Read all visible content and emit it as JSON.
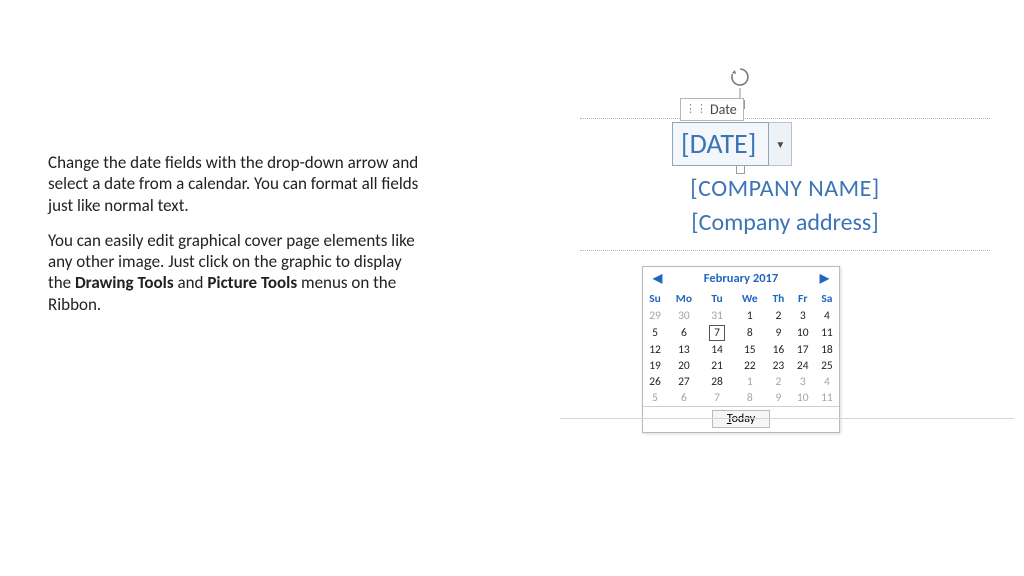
{
  "prose": {
    "p1": "Change the date fields with the drop-down arrow and select a date from a calendar. You can format all fields just like normal text.",
    "p2_a": "You can easily edit graphical cover page elements like any other image. Just click on the graphic to display the ",
    "p2_b": "Drawing Tools",
    "p2_c": " and ",
    "p2_d": "Picture Tools",
    "p2_e": " menus on the Ribbon."
  },
  "control": {
    "tag_label": "Date",
    "value_placeholder": "[DATE]"
  },
  "placeholders": {
    "company": "[COMPANY NAME]",
    "address": "[Company address]"
  },
  "calendar": {
    "month_title": "February 2017",
    "dow": [
      "Su",
      "Mo",
      "Tu",
      "We",
      "Th",
      "Fr",
      "Sa"
    ],
    "selected_day": 7,
    "weeks": [
      [
        {
          "d": 29,
          "other": true
        },
        {
          "d": 30,
          "other": true
        },
        {
          "d": 31,
          "other": true
        },
        {
          "d": 1
        },
        {
          "d": 2
        },
        {
          "d": 3
        },
        {
          "d": 4
        }
      ],
      [
        {
          "d": 5
        },
        {
          "d": 6
        },
        {
          "d": 7,
          "sel": true
        },
        {
          "d": 8
        },
        {
          "d": 9
        },
        {
          "d": 10
        },
        {
          "d": 11
        }
      ],
      [
        {
          "d": 12
        },
        {
          "d": 13
        },
        {
          "d": 14
        },
        {
          "d": 15
        },
        {
          "d": 16
        },
        {
          "d": 17
        },
        {
          "d": 18
        }
      ],
      [
        {
          "d": 19
        },
        {
          "d": 20
        },
        {
          "d": 21
        },
        {
          "d": 22
        },
        {
          "d": 23
        },
        {
          "d": 24
        },
        {
          "d": 25
        }
      ],
      [
        {
          "d": 26
        },
        {
          "d": 27
        },
        {
          "d": 28
        },
        {
          "d": 1,
          "other": true
        },
        {
          "d": 2,
          "other": true
        },
        {
          "d": 3,
          "other": true
        },
        {
          "d": 4,
          "other": true
        }
      ],
      [
        {
          "d": 5,
          "other": true
        },
        {
          "d": 6,
          "other": true
        },
        {
          "d": 7,
          "other": true
        },
        {
          "d": 8,
          "other": true
        },
        {
          "d": 9,
          "other": true
        },
        {
          "d": 10,
          "other": true
        },
        {
          "d": 11,
          "other": true
        }
      ]
    ],
    "today_label": "Today",
    "today_underline": "T"
  }
}
